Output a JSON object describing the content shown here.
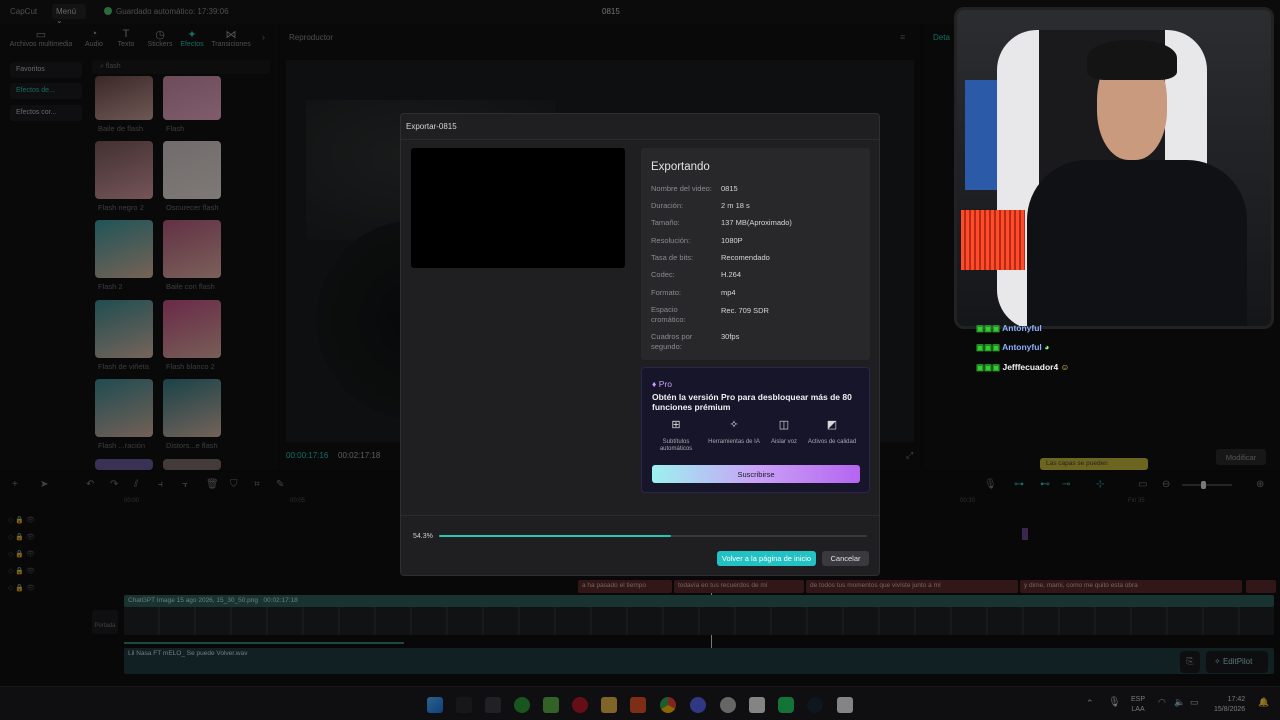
{
  "app": {
    "logo": "CapCut",
    "menu": "Menú",
    "autosave": "Guardado automático: 17:39:06",
    "project": "0815"
  },
  "left_tabs": [
    {
      "label": "Archivos multimedia",
      "icon": "media-icon"
    },
    {
      "label": "Audio",
      "icon": "audio-icon"
    },
    {
      "label": "Texto",
      "icon": "text-icon"
    },
    {
      "label": "Stickers",
      "icon": "sticker-icon"
    },
    {
      "label": "Efectos",
      "icon": "effects-icon"
    },
    {
      "label": "Transiciones",
      "icon": "transitions-icon"
    }
  ],
  "left_categories": [
    "Favoritos",
    "Efectos de...",
    "Efectos cor..."
  ],
  "search": {
    "value": "flash"
  },
  "effects": [
    "Baile de flash",
    "Flash",
    "Flash negro 2",
    "Oscurecer flash",
    "Flash 2",
    "Baile con flash",
    "Flash de viñeta",
    "Flash blanco 2",
    "Flash ...ración",
    "Distors...e flash"
  ],
  "player": {
    "title": "Reproductor",
    "current_time": "00:00:17:16",
    "duration": "00:02:17:18"
  },
  "right": {
    "tab": "Deta",
    "modify": "Modificar",
    "tooltip": "Las capas se pueden"
  },
  "timeline": {
    "clip_label": "ChatGPT Image 15 ago 2026, 15_30_50.png",
    "clip_duration": "00:02:17:18",
    "audio_label": "Lil Nasa FT mELO_ Se puede Volver.wav",
    "cover": "Portada",
    "subtitles": [
      "a ha pasado el tiempo",
      "todavía en tus recuerdos de mí",
      "de todos tus momentos que vivíste junto a mí",
      "y dime, mami, como me quito esta obra"
    ],
    "ticks": [
      "00:00",
      "00:05",
      "00:30",
      "Fin 35"
    ]
  },
  "export_dialog": {
    "title": "Exportar-0815",
    "heading": "Exportando",
    "rows": [
      {
        "key": "Nombre del video:",
        "value": "0815"
      },
      {
        "key": "Duración:",
        "value": "2 m 18 s"
      },
      {
        "key": "Tamaño:",
        "value": "137 MB(Aproximado)"
      },
      {
        "key": "Resolución:",
        "value": "1080P"
      },
      {
        "key": "Tasa de bits:",
        "value": "Recomendado"
      },
      {
        "key": "Codec:",
        "value": "H.264"
      },
      {
        "key": "Formato:",
        "value": "mp4"
      },
      {
        "key": "Espacio cromático:",
        "value": "Rec. 709 SDR"
      },
      {
        "key": "Cuadros por segundo:",
        "value": "30fps"
      }
    ],
    "pro": {
      "tag": "Pro",
      "message": "Obtén la versión Pro para desbloquear más de 80 funciones prémium",
      "features": [
        {
          "label": "Subtítulos automáticos",
          "icon": "subtitles-icon"
        },
        {
          "label": "Herramientas de IA",
          "icon": "ai-tools-icon"
        },
        {
          "label": "Aislar voz",
          "icon": "voice-icon"
        },
        {
          "label": "Activos de calidad",
          "icon": "assets-icon"
        }
      ],
      "subscribe": "Suscribirse"
    },
    "progress": {
      "percent_label": "54.3%",
      "value": 0.543
    },
    "home_button": "Volver a la página de inicio",
    "cancel_button": "Cancelar"
  },
  "chat": [
    {
      "user": "Antonyful"
    },
    {
      "user": "Antonyful"
    },
    {
      "user": "Jefffecuador4"
    }
  ],
  "editpilot": "EditPilot",
  "taskbar": {
    "lang1": "ESP",
    "lang2": "LAA",
    "time": "17:42",
    "date": "15/8/2026"
  },
  "colors": {
    "accent": "#26c6b6",
    "background": "#0d0d0e",
    "dialog": "#1f1f21"
  }
}
